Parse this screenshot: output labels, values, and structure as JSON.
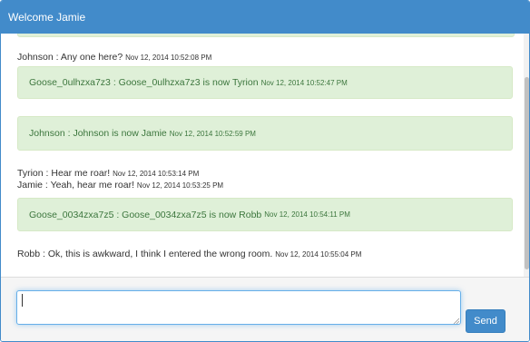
{
  "header": {
    "title": "Welcome Jamie"
  },
  "messages": [
    {
      "type": "chat",
      "sender": "Johnson",
      "text": "Any one here?",
      "time": "Nov 12, 2014 10:52:08 PM"
    },
    {
      "type": "notice",
      "sender": "Goose_0ulhzxa7z3",
      "text": "Goose_0ulhzxa7z3 is now Tyrion",
      "time": "Nov 12, 2014 10:52:47 PM"
    },
    {
      "type": "notice",
      "sender": "Johnson",
      "text": "Johnson is now Jamie",
      "time": "Nov 12, 2014 10:52:59 PM"
    },
    {
      "type": "chat",
      "sender": "Tyrion",
      "text": "Hear me roar!",
      "time": "Nov 12, 2014 10:53:14 PM"
    },
    {
      "type": "chat",
      "sender": "Jamie",
      "text": "Yeah, hear me roar!",
      "time": "Nov 12, 2014 10:53:25 PM"
    },
    {
      "type": "notice",
      "sender": "Goose_0034zxa7z5",
      "text": "Goose_0034zxa7z5 is now Robb",
      "time": "Nov 12, 2014 10:54:11 PM"
    },
    {
      "type": "chat",
      "sender": "Robb",
      "text": "Ok, this is awkward, I think I entered the wrong room.",
      "time": "Nov 12, 2014 10:55:04 PM"
    }
  ],
  "composer": {
    "value": "",
    "placeholder": "",
    "send_label": "Send"
  },
  "colors": {
    "primary": "#428bca",
    "success_bg": "#dff0d8",
    "success_text": "#3c763d"
  }
}
